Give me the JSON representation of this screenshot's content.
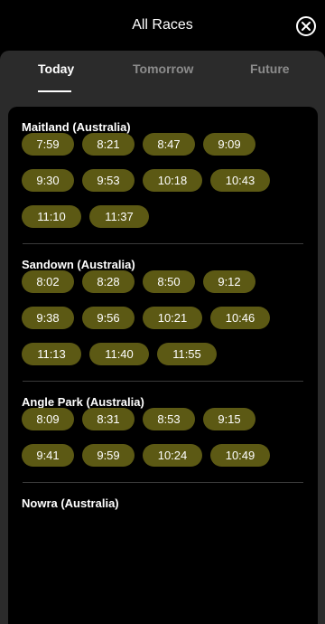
{
  "header": {
    "title": "All Races"
  },
  "tabs": [
    {
      "label": "Today"
    },
    {
      "label": "Tomorrow"
    },
    {
      "label": "Future"
    }
  ],
  "meetings": [
    {
      "name": "Maitland (Australia)",
      "times": [
        "7:59",
        "8:21",
        "8:47",
        "9:09",
        "9:30",
        "9:53",
        "10:18",
        "10:43",
        "11:10",
        "11:37"
      ]
    },
    {
      "name": "Sandown (Australia)",
      "times": [
        "8:02",
        "8:28",
        "8:50",
        "9:12",
        "9:38",
        "9:56",
        "10:21",
        "10:46",
        "11:13",
        "11:40",
        "11:55"
      ]
    },
    {
      "name": "Angle Park (Australia)",
      "times": [
        "8:09",
        "8:31",
        "8:53",
        "9:15",
        "9:41",
        "9:59",
        "10:24",
        "10:49"
      ]
    },
    {
      "name": "Nowra (Australia)",
      "times": []
    }
  ],
  "colors": {
    "time_pill": "#5c5914",
    "panel": "#2b2b2b",
    "background": "#000000"
  },
  "icons": {
    "close": "close-circle-icon"
  }
}
